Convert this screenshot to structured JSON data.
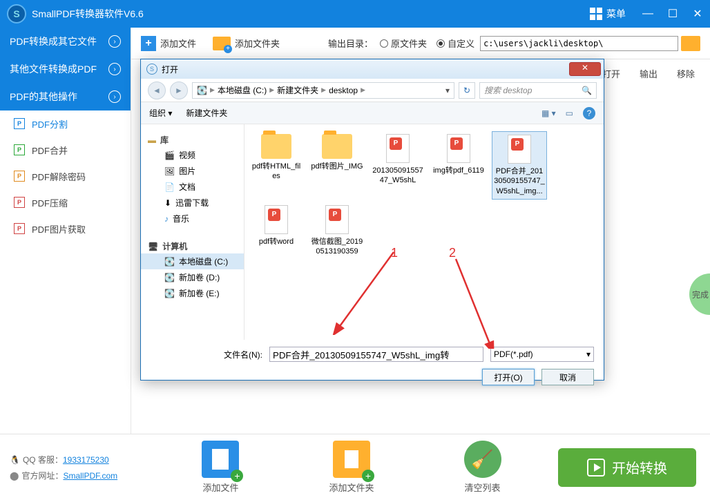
{
  "app": {
    "title": "SmallPDF转换器软件V6.6",
    "menu": "菜单"
  },
  "topbar": {
    "add_file": "添加文件",
    "add_folder": "添加文件夹",
    "out_label": "输出目录：",
    "radio_orig": "原文件夹",
    "radio_custom": "自定义",
    "path": "c:\\users\\jackli\\desktop\\"
  },
  "lvl2": {
    "open": "打开",
    "output": "输出",
    "remove": "移除"
  },
  "sidebar": {
    "cats": [
      "PDF转换成其它文件",
      "其他文件转换成PDF",
      "PDF的其他操作"
    ],
    "items": [
      "PDF分割",
      "PDF合并",
      "PDF解除密码",
      "PDF压缩",
      "PDF图片获取"
    ]
  },
  "done": "完成",
  "bottom": {
    "qq_label": "QQ 客服：",
    "qq": "1933175230",
    "site_label": "官方网址：",
    "site": "SmallPDF.com",
    "btn1": "添加文件",
    "btn2": "添加文件夹",
    "btn3": "清空列表",
    "start": "开始转换"
  },
  "dialog": {
    "title": "打开",
    "crumbs": [
      "本地磁盘 (C:)",
      "新建文件夹",
      "desktop"
    ],
    "search_ph": "搜索 desktop",
    "tb_org": "组织",
    "tb_new": "新建文件夹",
    "tree_lib": "库",
    "tree_items": [
      "视频",
      "图片",
      "文档",
      "迅雷下载",
      "音乐"
    ],
    "tree_pc": "计算机",
    "tree_drives": [
      "本地磁盘 (C:)",
      "新加卷 (D:)",
      "新加卷 (E:)"
    ],
    "files": [
      {
        "n": "pdf转HTML_files",
        "t": "folder"
      },
      {
        "n": "pdf转图片_IMG",
        "t": "folder"
      },
      {
        "n": "20130509155747_W5shL",
        "t": "pdf",
        "sel": false
      },
      {
        "n": "img转pdf_6119",
        "t": "pdf"
      },
      {
        "n": "PDF合并_20130509155747_W5shL_img...",
        "t": "pdf",
        "sel": true
      },
      {
        "n": "pdf转word",
        "t": "pdf"
      },
      {
        "n": "微信截图_20190513190359",
        "t": "pdf"
      }
    ],
    "fn_label": "文件名(N):",
    "fn_value": "PDF合并_20130509155747_W5shL_img转",
    "filter": "PDF(*.pdf)",
    "open_btn": "打开(O)",
    "cancel_btn": "取消"
  },
  "annot": {
    "a1": "1",
    "a2": "2"
  }
}
